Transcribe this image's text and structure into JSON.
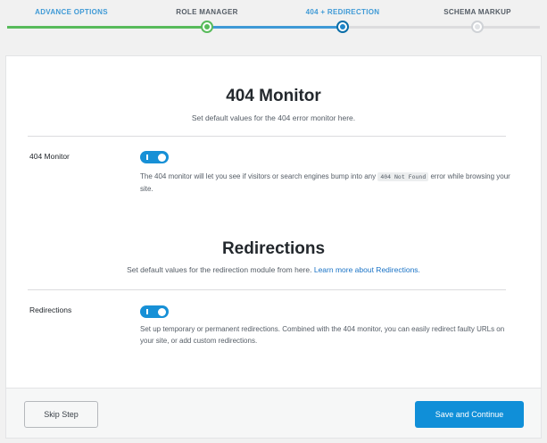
{
  "steps": [
    {
      "label": "ADVANCE OPTIONS",
      "state": "done"
    },
    {
      "label": "ROLE MANAGER",
      "state": "done"
    },
    {
      "label": "404 + REDIRECTION",
      "state": "active"
    },
    {
      "label": "SCHEMA MARKUP",
      "state": "todo"
    }
  ],
  "colors": {
    "done": "#58bb5b",
    "active": "#3f9ad6",
    "accent_button": "#108fd8",
    "toggle_on": "#1790d6"
  },
  "monitor": {
    "title": "404 Monitor",
    "description": "Set default values for the 404 error monitor here.",
    "field_label": "404 Monitor",
    "toggle_state": "on",
    "help_before": "The 404 monitor will let you see if visitors or search engines bump into any ",
    "help_code": "404 Not Found",
    "help_after": " error while browsing your site."
  },
  "redirections": {
    "title": "Redirections",
    "description": "Set default values for the redirection module from here. ",
    "learn_more": "Learn more about Redirections.",
    "field_label": "Redirections",
    "toggle_state": "on",
    "help": "Set up temporary or permanent redirections. Combined with the 404 monitor, you can easily redirect faulty URLs on your site, or add custom redirections."
  },
  "footer": {
    "skip_label": "Skip Step",
    "continue_label": "Save and Continue"
  }
}
